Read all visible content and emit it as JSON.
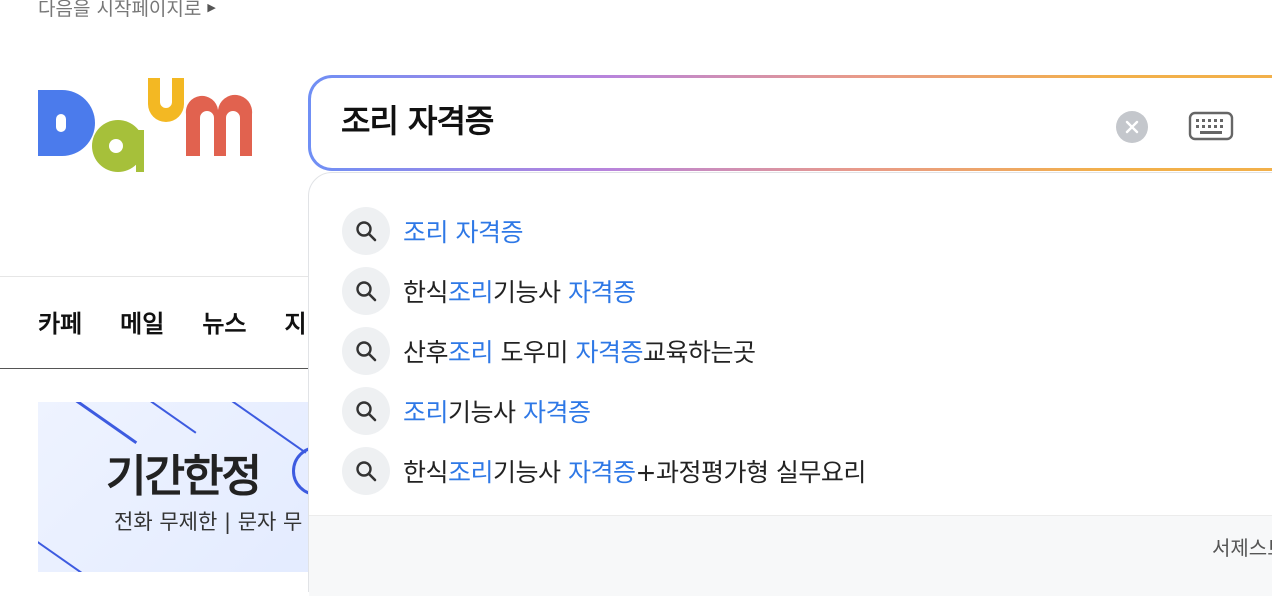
{
  "header": {
    "start_page_link": "다음을 시작페이지로",
    "logo_text": "Daum"
  },
  "nav": {
    "items": [
      "카페",
      "메일",
      "뉴스",
      "지"
    ]
  },
  "banner": {
    "title": "기간한정",
    "subtitle": "전화 무제한 | 문자 무"
  },
  "search": {
    "value": "조리 자격증",
    "clear_icon": "close-icon",
    "keyboard_icon": "keyboard-icon",
    "border_gradient": [
      "#6f8ff5",
      "#b884dc",
      "#e89a8a",
      "#f2b04a"
    ]
  },
  "suggestions": [
    [
      {
        "t": "조리 자격증",
        "h": true
      }
    ],
    [
      {
        "t": "한식",
        "h": false
      },
      {
        "t": "조리",
        "h": true
      },
      {
        "t": "기능사 ",
        "h": false
      },
      {
        "t": "자격증",
        "h": true
      }
    ],
    [
      {
        "t": "산후",
        "h": false
      },
      {
        "t": "조리",
        "h": true
      },
      {
        "t": " 도우미 ",
        "h": false
      },
      {
        "t": "자격증",
        "h": true
      },
      {
        "t": "교육하는곳",
        "h": false
      }
    ],
    [
      {
        "t": "조리",
        "h": true
      },
      {
        "t": "기능사 ",
        "h": false
      },
      {
        "t": "자격증",
        "h": true
      }
    ],
    [
      {
        "t": "한식",
        "h": false
      },
      {
        "t": "조리",
        "h": true
      },
      {
        "t": "기능사 ",
        "h": false
      },
      {
        "t": "자격증",
        "h": true
      },
      {
        "t": "+과정평가형 실무요리",
        "h": false
      }
    ]
  ],
  "suggest_footer": {
    "link": "서제스트"
  },
  "colors": {
    "highlight": "#2e78e6",
    "logo_blue": "#4b7bec",
    "logo_green": "#a6c03a",
    "logo_yellow": "#f3b823",
    "logo_red": "#e1624f"
  }
}
